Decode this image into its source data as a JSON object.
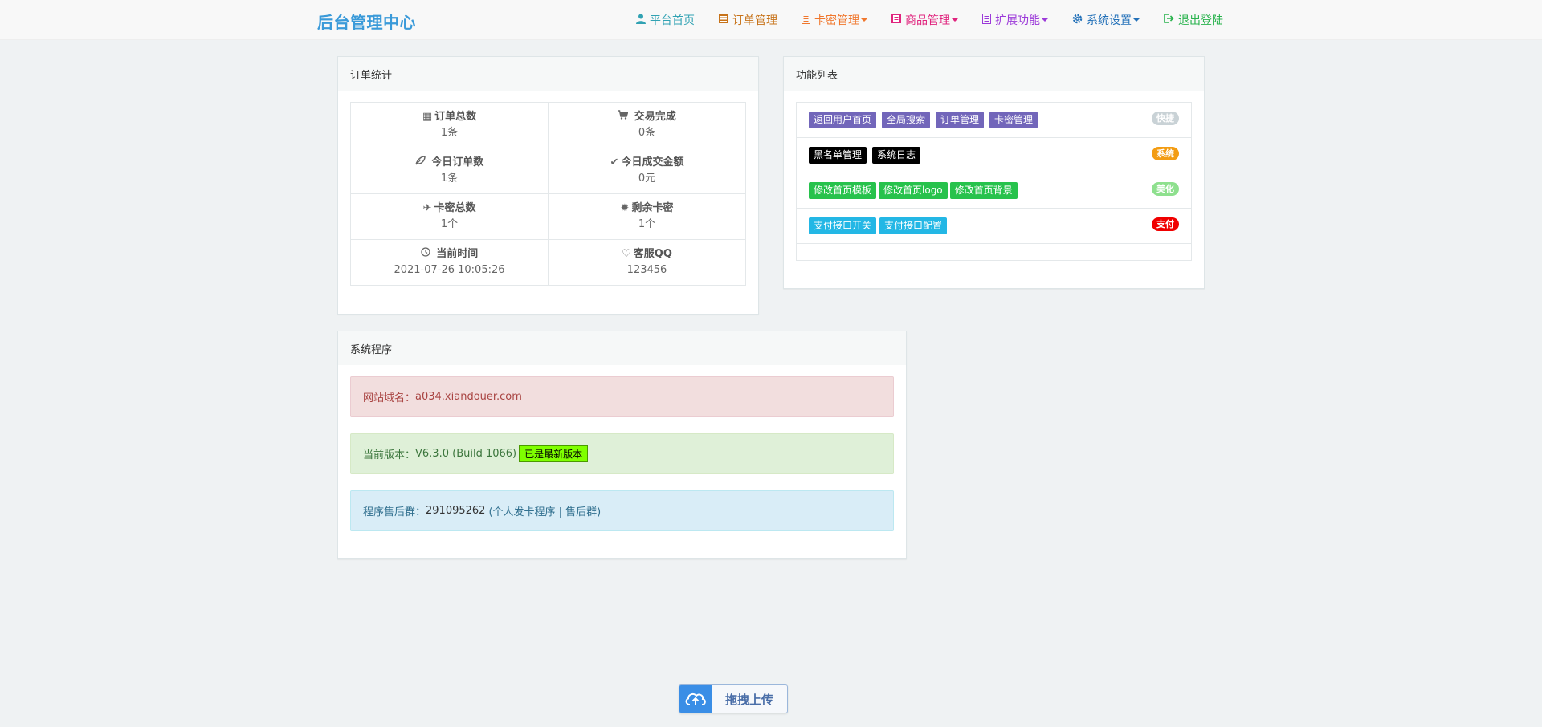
{
  "nav": {
    "brand": "后台管理中心",
    "items": [
      {
        "label": "平台首页",
        "icon": "user-icon",
        "color": "#31a2b3",
        "dropdown": false
      },
      {
        "label": "订单管理",
        "icon": "list-icon",
        "color": "#c7731a",
        "dropdown": false
      },
      {
        "label": "卡密管理",
        "icon": "card-icon",
        "color": "#f0772d",
        "dropdown": true
      },
      {
        "label": "商品管理",
        "icon": "goods-icon",
        "color": "#e0247e",
        "dropdown": true
      },
      {
        "label": "扩展功能",
        "icon": "extend-icon",
        "color": "#9c3ad9",
        "dropdown": true
      },
      {
        "label": "系统设置",
        "icon": "gear-icon",
        "color": "#2270b8",
        "dropdown": true
      },
      {
        "label": "退出登陆",
        "icon": "logout-icon",
        "color": "#2ab34e",
        "dropdown": false
      }
    ]
  },
  "order_stats": {
    "title": "订单统计",
    "cells": [
      {
        "label": "订单总数",
        "value": "1条",
        "icon": "grid-icon"
      },
      {
        "label": "交易完成",
        "value": "0条",
        "icon": "cart-icon"
      },
      {
        "label": "今日订单数",
        "value": "1条",
        "icon": "leaf-icon"
      },
      {
        "label": "今日成交金额",
        "value": "0元",
        "icon": "check-icon"
      },
      {
        "label": "卡密总数",
        "value": "1个",
        "icon": "plane-icon"
      },
      {
        "label": "剩余卡密",
        "value": "1个",
        "icon": "asterisk-icon"
      },
      {
        "label": "当前时间",
        "value": "2021-07-26 10:05:26",
        "icon": "clock-icon"
      },
      {
        "label": "客服QQ",
        "value": "123456",
        "icon": "heart-icon"
      }
    ]
  },
  "function_list": {
    "title": "功能列表",
    "rows": [
      {
        "buttons": [
          "返回用户首页",
          "全局搜索",
          "订单管理",
          "卡密管理"
        ],
        "btn_color": "#7266ba",
        "badge": "快捷",
        "badge_color": "#c9d2d6"
      },
      {
        "buttons": [
          "黑名单管理",
          "系统日志"
        ],
        "btn_color": "#000000",
        "badge": "系统",
        "badge_color": "#f39c12"
      },
      {
        "buttons": [
          "修改首页模板",
          "修改首页logo",
          "修改首页背景"
        ],
        "btn_color": "#27c24c",
        "badge": "美化",
        "badge_color": "#8ee08e"
      },
      {
        "buttons": [
          "支付接口开关",
          "支付接口配置"
        ],
        "btn_color": "#23b7e5",
        "badge": "支付",
        "badge_color": "#f00000"
      }
    ]
  },
  "system": {
    "title": "系统程序",
    "domain_label": "网站域名：",
    "domain_value": "a034.xiandouer.com",
    "version_label": "当前版本：",
    "version_value": "V6.3.0 (Build 1066)",
    "version_badge": "已是最新版本",
    "group_label": "程序售后群：",
    "group_value": "291095262",
    "group_note": "(个人发卡程序 | 售后群)"
  },
  "upload": {
    "label": "拖拽上传",
    "icon": "cloud-upload-icon"
  }
}
